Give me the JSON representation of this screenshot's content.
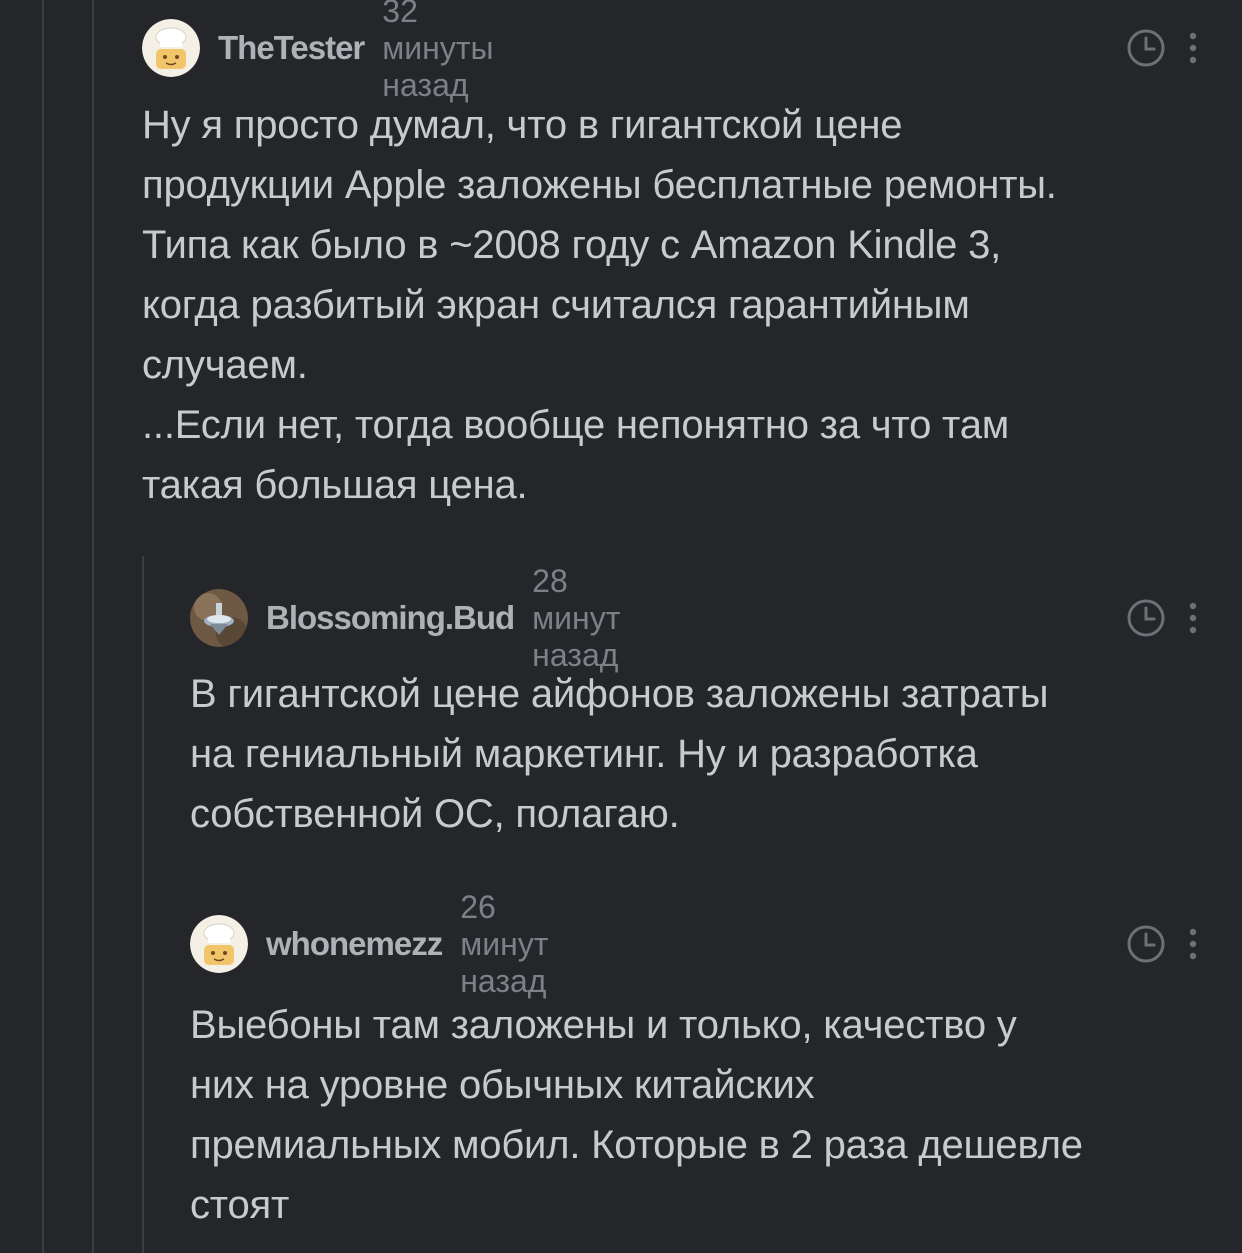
{
  "comments": [
    {
      "author": "TheTester",
      "time": "32 минуты назад",
      "avatar_icon": "chef-avatar-icon",
      "text": "Ну я просто думал, что в гигантской цене\nпродукции Apple заложены бесплатные ремонты.\nТипа как было в ~2008 году с Amazon Kindle 3,\nкогда разбитый экран считался гарантийным\nслучаем.\n...Если нет, тогда вообще непонятно за что там\nтакая большая цена."
    },
    {
      "author": "Blossoming.Bud",
      "time": "28 минут назад",
      "avatar_icon": "spinning-top-avatar-icon",
      "text": "В гигантской цене айфонов заложены затраты\nна гениальный маркетинг. Ну и разработка\nсобственной ОС, полагаю."
    },
    {
      "author": "whonemezz",
      "time": "26 минут назад",
      "avatar_icon": "chef-avatar-icon",
      "text": "Выебоны там заложены и только, качество у\nних на уровне обычных китайских\nпремиальных мобил. Которые в 2 раза дешевле\nстоят"
    }
  ],
  "icons": {
    "clock": "clock-icon",
    "more": "more-vertical-icon"
  },
  "colors": {
    "background": "#24262a",
    "thread_line": "#3a3d42",
    "author": "#aeb1b5",
    "time": "#7d8086",
    "text": "#c8cacd"
  }
}
